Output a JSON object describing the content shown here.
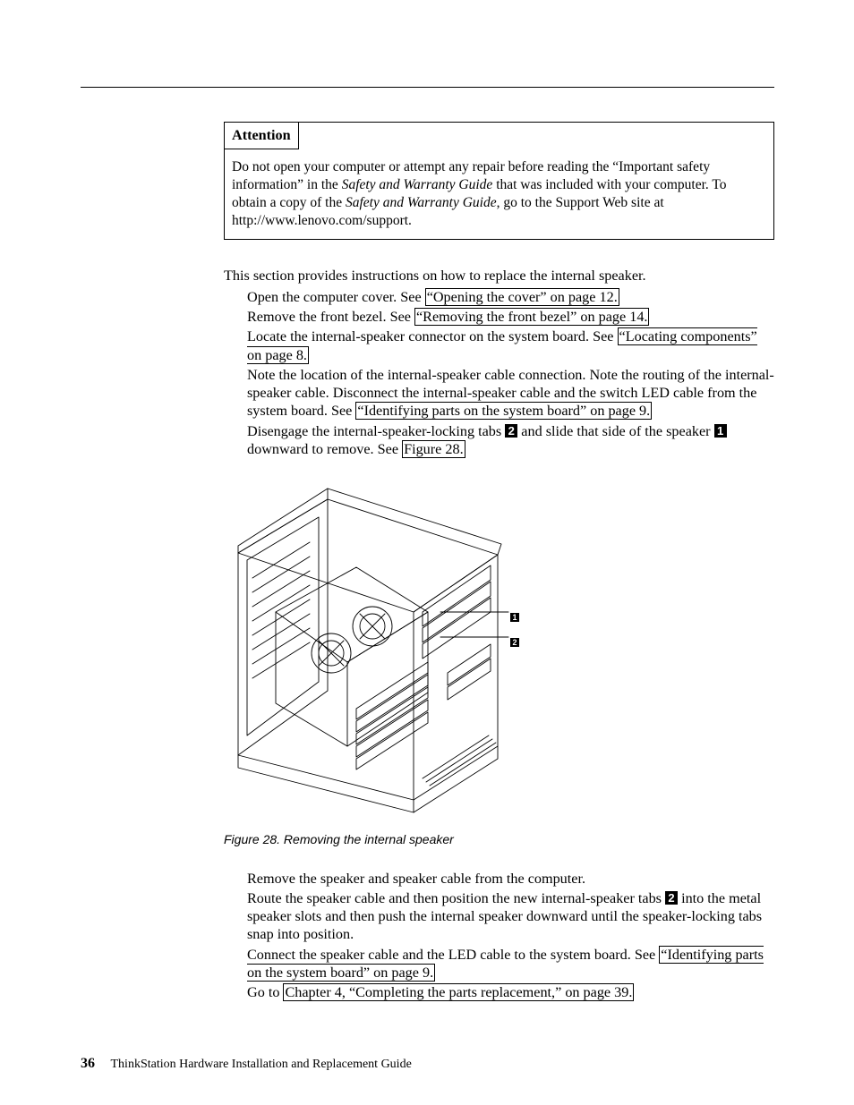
{
  "attention": {
    "title": "Attention",
    "body_pre": "Do not open your computer or attempt any repair before reading the “Important safety information” in the ",
    "guide_title": "Safety and Warranty Guide",
    "body_mid": " that was included with your computer. To obtain a copy of the ",
    "body_post": ", go to the Support Web site at http://www.lenovo.com/support."
  },
  "intro": "This section provides instructions on how to replace the internal speaker.",
  "steps_a": [
    {
      "pre": "Open the computer cover. See ",
      "link": "“Opening the cover” on page 12."
    },
    {
      "pre": "Remove the front bezel. See ",
      "link": "“Removing the front bezel” on page 14."
    },
    {
      "pre": "Locate the internal-speaker connector on the system board. See ",
      "link": "“Locating components” on page 8."
    },
    {
      "plain_pre": "Note the location of the internal-speaker cable connection. Note the routing of the internal-speaker cable. Disconnect the internal-speaker cable and the switch LED cable from the system board. See ",
      "link": "“Identifying parts on the system board” on page 9."
    }
  ],
  "step5": {
    "pre": "Disengage the internal-speaker-locking tabs ",
    "c1": "2",
    "mid1": " and slide that side of the speaker ",
    "c2": "1",
    "mid2": " downward to remove. See ",
    "link": "Figure 28."
  },
  "figure": {
    "caption": "Figure 28. Removing the internal speaker",
    "c1": "1",
    "c2": "2"
  },
  "steps_b": {
    "s6": "Remove the speaker and speaker cable from the computer.",
    "s7_pre": "Route the speaker cable and then position the new internal-speaker tabs ",
    "s7_c": "2",
    "s7_post": " into the metal speaker slots and then push the internal speaker downward until the speaker-locking tabs snap into position.",
    "s8_pre": "Connect the speaker cable and the LED cable to the system board. See ",
    "s8_link": "“Identifying parts on the system board” on page 9.",
    "s9_pre": "Go to ",
    "s9_link": "Chapter 4, “Completing the parts replacement,” on page 39."
  },
  "footer": {
    "page": "36",
    "book": "ThinkStation Hardware Installation and Replacement Guide"
  }
}
